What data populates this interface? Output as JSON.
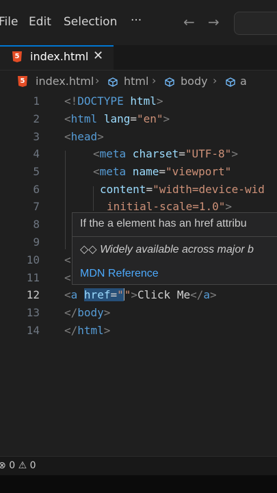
{
  "menubar": {
    "items": [
      "File",
      "Edit",
      "Selection"
    ],
    "more": "···",
    "back": "←",
    "forward": "→"
  },
  "tab": {
    "label": "index.html",
    "close": "✕"
  },
  "breadcrumb": [
    "index.html",
    "html",
    "body",
    "a"
  ],
  "editor": {
    "active_line": 12,
    "line_numbers": [
      "1",
      "2",
      "3",
      "4",
      "5",
      "6",
      "7",
      "8",
      "9",
      "10",
      "11",
      "12",
      "13",
      "14"
    ],
    "lines": {
      "l1": {
        "open": "<!",
        "doctype": "DOCTYPE",
        "space": " ",
        "html": "html",
        "close": ">"
      },
      "l2": {
        "open": "<",
        "tag": "html",
        "attr": " lang",
        "eq": "=",
        "val": "\"en\"",
        "close": ">"
      },
      "l3": {
        "open": "<",
        "tag": "head",
        "close": ">"
      },
      "l4": {
        "open": "<",
        "tag": "meta",
        "attr": " charset",
        "eq": "=",
        "val": "\"UTF-8\"",
        "close": ">"
      },
      "l5": {
        "open": "<",
        "tag": "meta",
        "attr": " name",
        "eq": "=",
        "val": "\"viewport\""
      },
      "l6": {
        "attr": "content",
        "eq": "=",
        "val": "\"width=device-wid"
      },
      "l7": {
        "val": "initial-scale=1.0\"",
        "close": ">"
      },
      "l10": {
        "open": "<"
      },
      "l11": {
        "open": "<"
      },
      "l12": {
        "open": "<",
        "tag": "a",
        "attr": "href",
        "eq": "=",
        "q1": "\"",
        "q2": "\"",
        "close": ">",
        "text": "Click Me",
        "endopen": "</",
        "endtag": "a",
        "endclose": ">"
      },
      "l13": {
        "open": "</",
        "tag": "body",
        "close": ">"
      },
      "l14": {
        "open": "</",
        "tag": "html",
        "close": ">"
      }
    }
  },
  "hover": {
    "description": "If the a element has an href attribu",
    "baseline_icon": "◇◇",
    "baseline": "Widely available across major b",
    "link": "MDN Reference"
  },
  "status": {
    "errors_icon": "⊗",
    "errors": "0",
    "warnings_icon": "⚠",
    "warnings": "0"
  },
  "colors": {
    "accent": "#0078d4",
    "html5": "#e44d26",
    "tag": "#569cd6",
    "attribute": "#9cdcfe",
    "string": "#ce9178"
  }
}
